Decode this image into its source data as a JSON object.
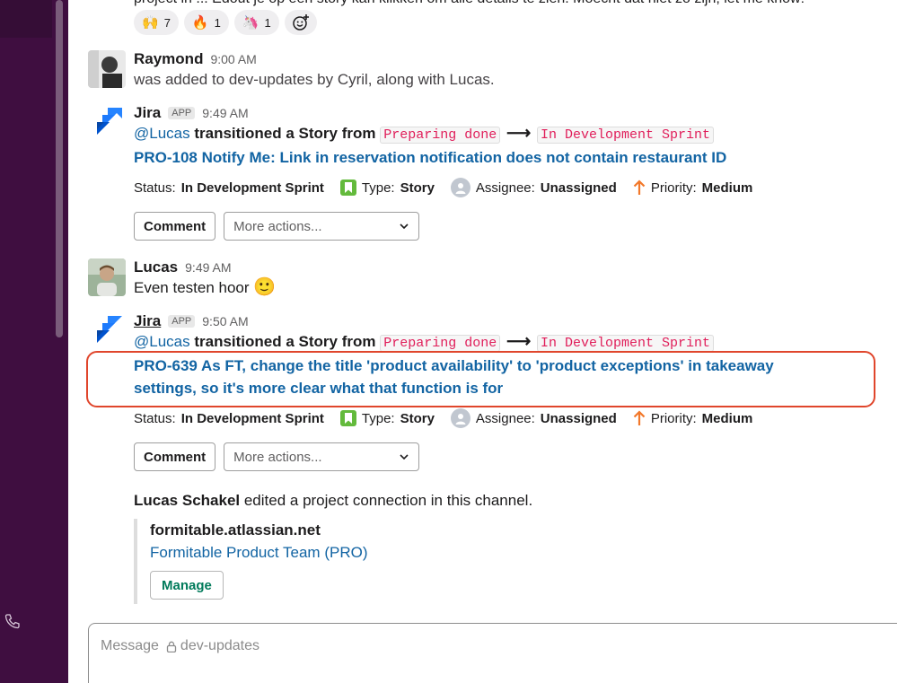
{
  "top_message": {
    "cut_text": "project in ... Edout je op een story kan klikken om alle details te zien. Moecht dat niet zo zijn, let me know!",
    "reactions": [
      {
        "emoji": "🙌",
        "icon": "raised-hands-emoji",
        "count": "7"
      },
      {
        "emoji": "🔥",
        "icon": "fire-emoji",
        "count": "1"
      },
      {
        "emoji": "🦄",
        "icon": "unicorn-emoji",
        "count": "1"
      }
    ]
  },
  "messages": {
    "raymond": {
      "name": "Raymond",
      "time": "9:00 AM",
      "text": "was added to dev-updates by Cyril, along with Lucas."
    },
    "jira1": {
      "name": "Jira",
      "badge": "APP",
      "time": "9:49 AM",
      "mention": "@Lucas",
      "action": " transitioned a Story from ",
      "from_state": "Preparing done",
      "arrow": "⟶",
      "to_state": "In Development Sprint",
      "issue_title": "PRO-108 Notify Me: Link in reservation notification does not contain restaurant ID",
      "status_label": "Status:",
      "status_value": "In Development Sprint",
      "type_label": "Type:",
      "type_value": "Story",
      "assignee_label": "Assignee:",
      "assignee_value": "Unassigned",
      "priority_label": "Priority:",
      "priority_value": "Medium",
      "comment_label": "Comment",
      "more_actions": "More actions..."
    },
    "lucas": {
      "name": "Lucas",
      "time": "9:49 AM",
      "text": "Even testen hoor",
      "emoji": "🙂"
    },
    "jira2": {
      "name": "Jira",
      "badge": "APP",
      "time": "9:50 AM",
      "mention": "@Lucas",
      "action": " transitioned a Story from ",
      "from_state": "Preparing done",
      "arrow": "⟶",
      "to_state": "In Development Sprint",
      "issue_title_line1": "PRO-639 As FT, change the title 'product availability' to 'product exceptions' in takeaway",
      "issue_title_line2": "settings, so it's more clear what that function is for",
      "status_label": "Status:",
      "status_value": "In Development Sprint",
      "type_label": "Type:",
      "type_value": "Story",
      "assignee_label": "Assignee:",
      "assignee_value": "Unassigned",
      "priority_label": "Priority:",
      "priority_value": "Medium",
      "comment_label": "Comment",
      "more_actions": "More actions..."
    }
  },
  "connection": {
    "editor": "Lucas Schakel",
    "text": " edited a project connection in this channel.",
    "site": "formitable.atlassian.net",
    "project": "Formitable Product Team (PRO)",
    "manage_label": "Manage"
  },
  "composer": {
    "placeholder_prefix": "Message",
    "channel": "dev-updates"
  },
  "colors": {
    "sidebar": "#3f0e40",
    "link": "#1264a3",
    "code": "#e01e5a",
    "highlight": "#e0462c",
    "manage": "#007a5a"
  }
}
